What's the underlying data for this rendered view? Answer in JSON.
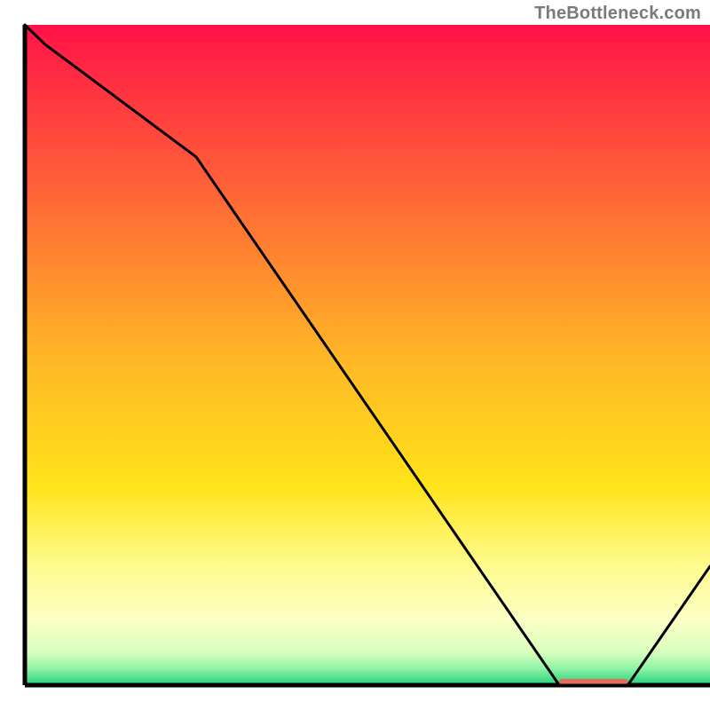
{
  "watermark": "TheBottleneck.com",
  "chart_data": {
    "type": "line",
    "title": "",
    "xlabel": "",
    "ylabel": "",
    "xlim": [
      0,
      100
    ],
    "ylim": [
      0,
      100
    ],
    "x": [
      0,
      3,
      25,
      78,
      88,
      100
    ],
    "values": [
      100,
      97,
      80,
      0,
      0,
      18
    ],
    "gradient_stops": [
      {
        "offset": 0.0,
        "color": "#ff1248"
      },
      {
        "offset": 0.5,
        "color": "#ffb526"
      },
      {
        "offset": 0.7,
        "color": "#ffe41a"
      },
      {
        "offset": 0.82,
        "color": "#fffb8f"
      },
      {
        "offset": 0.9,
        "color": "#fcffc4"
      },
      {
        "offset": 0.95,
        "color": "#d9ffbf"
      },
      {
        "offset": 0.975,
        "color": "#8ef3a5"
      },
      {
        "offset": 1.0,
        "color": "#23d07a"
      }
    ],
    "marker": {
      "x_start": 78,
      "x_end": 88,
      "y": 0,
      "color": "#e86a5a",
      "label": ""
    },
    "axis_color": "#000000",
    "line_color": "#000000",
    "line_width": 3,
    "background": "#ffffff"
  }
}
